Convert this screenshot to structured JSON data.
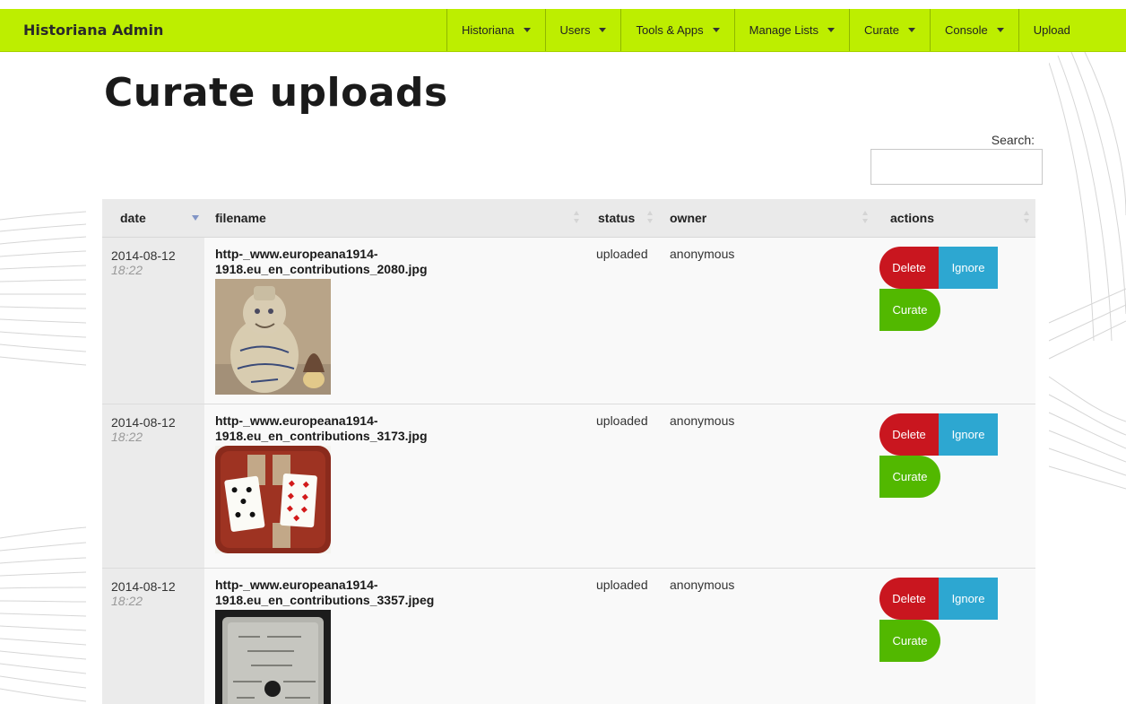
{
  "app": {
    "title": "Historiana Admin"
  },
  "nav": {
    "items": [
      {
        "label": "Historiana",
        "dropdown": true
      },
      {
        "label": "Users",
        "dropdown": true
      },
      {
        "label": "Tools & Apps",
        "dropdown": true
      },
      {
        "label": "Manage Lists",
        "dropdown": true
      },
      {
        "label": "Curate",
        "dropdown": true
      },
      {
        "label": "Console",
        "dropdown": true
      },
      {
        "label": "Upload",
        "dropdown": false
      }
    ]
  },
  "page": {
    "title": "Curate uploads"
  },
  "search": {
    "label": "Search:",
    "value": ""
  },
  "table": {
    "columns": [
      "date",
      "filename",
      "status",
      "owner",
      "actions"
    ],
    "sorted_column": "date",
    "sort_direction": "descending",
    "rows": [
      {
        "date": "2014-08-12",
        "time": "18:22",
        "filename": "http-_www.europeana1914-1918.eu_en_contributions_2080.jpg",
        "status": "uploaded",
        "owner": "anonymous"
      },
      {
        "date": "2014-08-12",
        "time": "18:22",
        "filename": "http-_www.europeana1914-1918.eu_en_contributions_3173.jpg",
        "status": "uploaded",
        "owner": "anonymous"
      },
      {
        "date": "2014-08-12",
        "time": "18:22",
        "filename": "http-_www.europeana1914-1918.eu_en_contributions_3357.jpeg",
        "status": "uploaded",
        "owner": "anonymous"
      }
    ],
    "actions": {
      "delete": "Delete",
      "ignore": "Ignore",
      "curate": "Curate"
    }
  },
  "colors": {
    "navbar": "#bdee00",
    "delete": "#c9161f",
    "ignore": "#2da7d1",
    "curate": "#52b800"
  }
}
